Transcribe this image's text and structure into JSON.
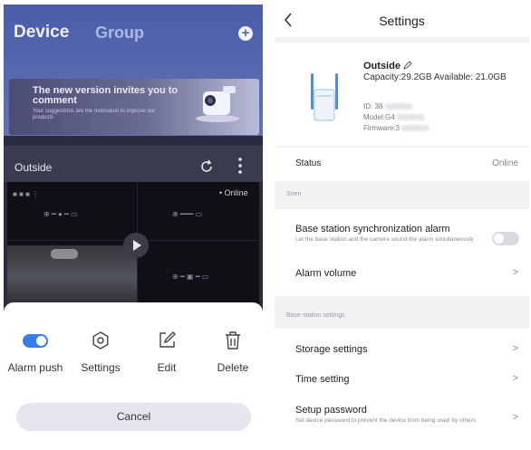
{
  "left": {
    "tabs": {
      "device": "Device",
      "group": "Group"
    },
    "banner": {
      "title": "The new version invites you to comment",
      "subtitle": "Your suggestions are the motivation to improve our products"
    },
    "camera": {
      "name": "Outside",
      "status": "• Online"
    },
    "actions": {
      "alarm_push": "Alarm push",
      "settings": "Settings",
      "edit": "Edit",
      "delete": "Delete"
    },
    "cancel": "Cancel",
    "colors": {
      "accent": "#3b7be8",
      "header": "#5566ad"
    }
  },
  "right": {
    "title": "Settings",
    "device": {
      "name": "Outside",
      "capacity": "Capacity:29.2GB Available: 21.0GB",
      "id_label": "ID: 38",
      "model_label": "Model:G4",
      "firmware_label": "Firmware:3"
    },
    "status": {
      "label": "Status",
      "value": "Online"
    },
    "sections": {
      "siren": "Siren",
      "base_station": "Base station settings"
    },
    "siren": {
      "sync_label": "Base station synchronization alarm",
      "sync_desc": "Let the base station and the camera sound the alarm simultaneously",
      "volume_label": "Alarm volume"
    },
    "base_station": {
      "storage": "Storage settings",
      "time": "Time setting",
      "password": "Setup password",
      "password_desc": "Set device password to prevent the device from being used by others"
    },
    "chevron": ">"
  }
}
